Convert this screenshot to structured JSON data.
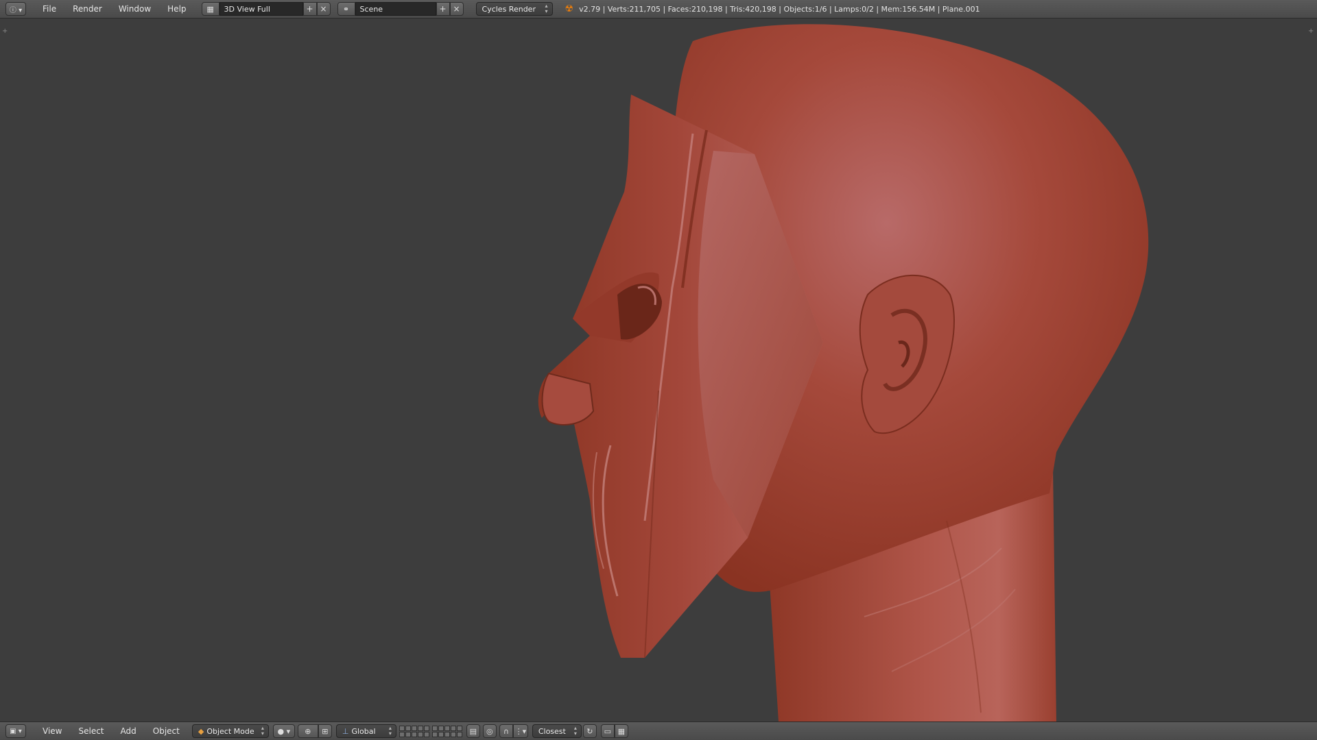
{
  "top_header": {
    "menus": [
      "File",
      "Render",
      "Window",
      "Help"
    ],
    "screen_layout": "3D View Full",
    "scene": "Scene",
    "render_engine": "Cycles Render",
    "stats": "v2.79 | Verts:211,705 | Faces:210,198 | Tris:420,198 | Objects:1/6 | Lamps:0/2 | Mem:156.54M | Plane.001"
  },
  "viewport": {
    "background_color": "#3d3d3d",
    "model_color": "#a8493a"
  },
  "bottom_header": {
    "menus": [
      "View",
      "Select",
      "Add",
      "Object"
    ],
    "mode": "Object Mode",
    "orientation": "Global",
    "snap_target": "Closest"
  }
}
